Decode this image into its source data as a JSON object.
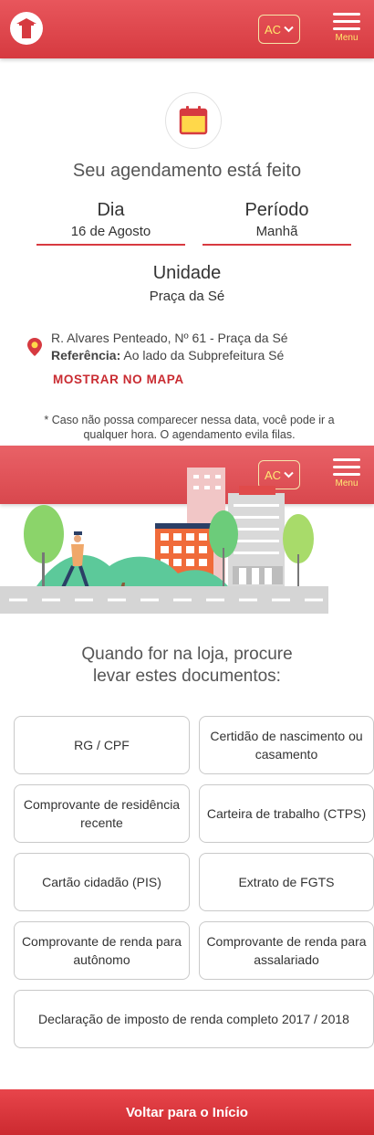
{
  "header": {
    "state": "AC",
    "menu_label": "Menu"
  },
  "confirmation": {
    "title": "Seu agendamento está feito",
    "day_label": "Dia",
    "day_value": "16 de Agosto",
    "period_label": "Período",
    "period_value": "Manhã",
    "unit_label": "Unidade",
    "unit_value": "Praça da Sé",
    "address": "R. Alvares Penteado, Nº 61 - Praça da Sé",
    "reference_label": "Referência:",
    "reference_value": "Ao lado da Subprefeitura Sé",
    "map_link": "MOSTRAR NO MAPA",
    "note": "* Caso não possa comparecer nessa data, você pode ir a qualquer hora. O agendamento evila filas."
  },
  "documents": {
    "title_line1": "Quando for na loja, procure",
    "title_line2": "levar estes documentos:",
    "items": [
      "RG / CPF",
      "Certidão de nascimento ou casamento",
      "Comprovante de residência recente",
      "Carteira de trabalho (CTPS)",
      "Cartão cidadão (PIS)",
      "Extrato de FGTS",
      "Comprovante de renda para autônomo",
      "Comprovante de renda para assalariado",
      "Declaração de imposto de renda completo 2017 / 2018"
    ]
  },
  "footer": {
    "back_label": "Voltar para o Início"
  },
  "colors": {
    "brand_red": "#d63a40",
    "accent_yellow": "#ffe86b"
  }
}
